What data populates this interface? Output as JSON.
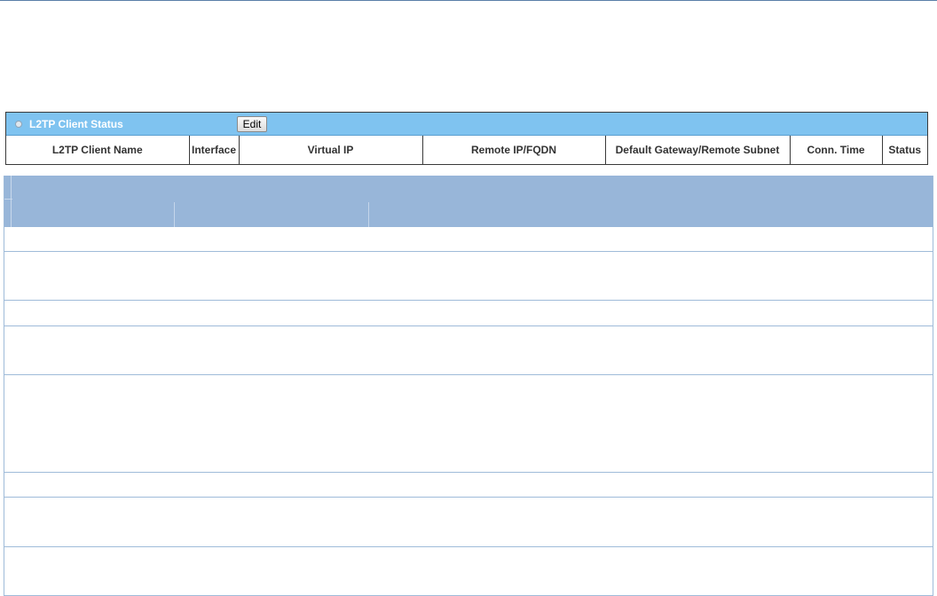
{
  "status_panel": {
    "title": "L2TP Client Status",
    "edit_label": "Edit",
    "columns": [
      "L2TP Client Name",
      "Interface",
      "Virtual IP",
      "Remote IP/FQDN",
      "Default Gateway/Remote Subnet",
      "Conn. Time",
      "Status"
    ]
  },
  "colors": {
    "title_bar": "#7fc3f0",
    "config_header": "#98b6d9",
    "row_border": "#9fbbd9"
  }
}
